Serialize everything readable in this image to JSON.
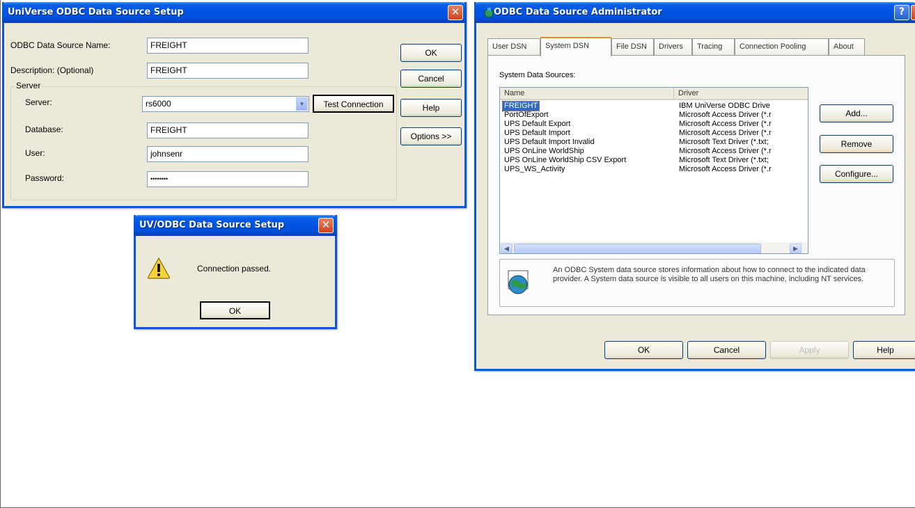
{
  "setup_dialog": {
    "title": "UniVerse ODBC Data Source Setup",
    "dsn_label": "ODBC Data Source Name:",
    "dsn_value": "FREIGHT",
    "description_label": "Description: (Optional)",
    "description_value": "FREIGHT",
    "server_group_label": "Server",
    "server_label": "Server:",
    "server_value": "rs6000",
    "test_connection_label": "Test Connection",
    "database_label": "Database:",
    "database_value": "FREIGHT",
    "user_label": "User:",
    "user_value": "johnsenr",
    "password_label": "Password:",
    "password_value": "••••••••",
    "ok_label": "OK",
    "cancel_label": "Cancel",
    "help_label": "Help",
    "options_label": "Options >>"
  },
  "message_box": {
    "title": "UV/ODBC Data Source Setup",
    "message": "Connection passed.",
    "ok_label": "OK",
    "icon": "warning-icon"
  },
  "admin_dialog": {
    "title": "ODBC Data Source Administrator",
    "tabs": [
      "User DSN",
      "System DSN",
      "File DSN",
      "Drivers",
      "Tracing",
      "Connection Pooling",
      "About"
    ],
    "active_tab": "System DSN",
    "list_caption": "System Data Sources:",
    "columns": [
      "Name",
      "Driver"
    ],
    "rows": [
      {
        "name": "FREIGHT",
        "driver": "IBM UniVerse ODBC Drive"
      },
      {
        "name": "PortOfExport",
        "driver": "Microsoft Access Driver (*.r"
      },
      {
        "name": "UPS Default Export",
        "driver": "Microsoft Access Driver (*.r"
      },
      {
        "name": "UPS Default Import",
        "driver": "Microsoft Access Driver (*.r"
      },
      {
        "name": "UPS Default Import Invalid",
        "driver": "Microsoft Text Driver (*.txt;"
      },
      {
        "name": "UPS OnLine WorldShip",
        "driver": "Microsoft Access Driver (*.r"
      },
      {
        "name": "UPS OnLine WorldShip CSV Export",
        "driver": "Microsoft Text Driver (*.txt;"
      },
      {
        "name": "UPS_WS_Activity",
        "driver": "Microsoft Access Driver (*.r"
      }
    ],
    "add_label": "Add...",
    "remove_label": "Remove",
    "configure_label": "Configure...",
    "info_text": "An ODBC System data source stores information about how to connect to the indicated data provider.   A System data source is visible to all users on this machine, including NT services.",
    "ok_label": "OK",
    "cancel_label": "Cancel",
    "apply_label": "Apply",
    "help_label": "Help"
  },
  "colors": {
    "titlebar": "#0054e3",
    "dialog_face": "#ece9d8",
    "selection": "#316ac5"
  }
}
